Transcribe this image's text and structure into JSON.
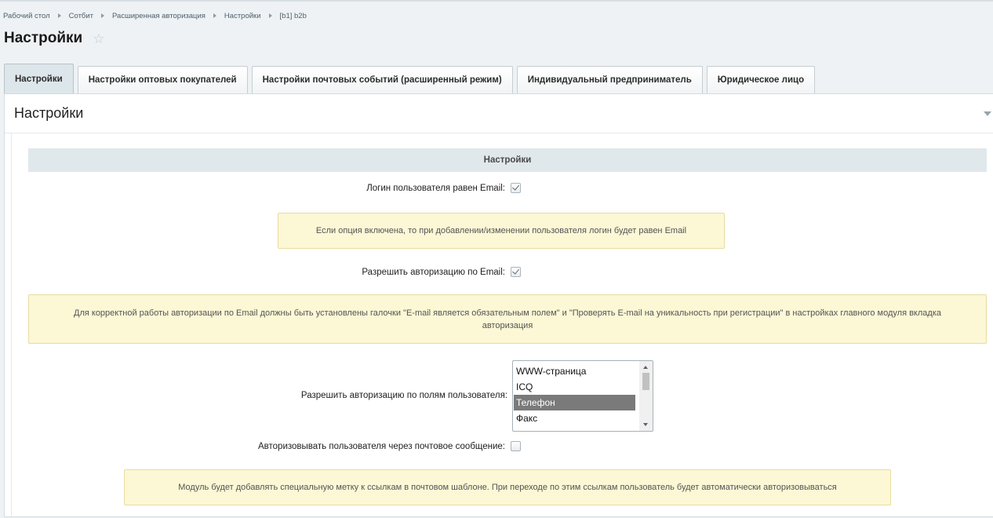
{
  "breadcrumb": [
    "Рабочий стол",
    "Сотбит",
    "Расширенная авторизация",
    "Настройки",
    "[b1] b2b"
  ],
  "page_title": "Настройки",
  "tabs": [
    {
      "label": "Настройки",
      "active": true
    },
    {
      "label": "Настройки оптовых покупателей",
      "active": false
    },
    {
      "label": "Настройки почтовых событий (расширенный режим)",
      "active": false
    },
    {
      "label": "Индивидуальный предприниматель",
      "active": false
    },
    {
      "label": "Юридическое лицо",
      "active": false
    }
  ],
  "panel": {
    "title": "Настройки",
    "section_heading": "Настройки",
    "login_email": {
      "label": "Логин пользователя равен Email:",
      "checked": true
    },
    "login_email_note": "Если опция включена, то при добавлении/изменении пользователя логин будет равен Email",
    "auth_email": {
      "label": "Разрешить авторизацию по Email:",
      "checked": true
    },
    "auth_email_note": "Для корректной работы авторизации по Email должны быть установлены галочки \"E-mail является обязательным полем\" и \"Проверять E-mail на уникальность при регистрации\" в настройках главного модуля вкладка авторизация",
    "auth_fields": {
      "label": "Разрешить авторизацию по полям пользователя:",
      "options": [
        "WWW-страница",
        "ICQ",
        "Телефон",
        "Факс"
      ],
      "selected": "Телефон"
    },
    "auth_mail": {
      "label": "Авторизовывать пользователя через почтовое сообщение:",
      "checked": false
    },
    "auth_mail_note": "Модуль будет добавлять специальную метку к ссылкам в почтовом шаблоне. При переходе по этим ссылкам пользователь будет автоматически авторизовываться"
  },
  "icons": {
    "favorite": "star-icon",
    "collapse": "chevron-down-icon"
  }
}
